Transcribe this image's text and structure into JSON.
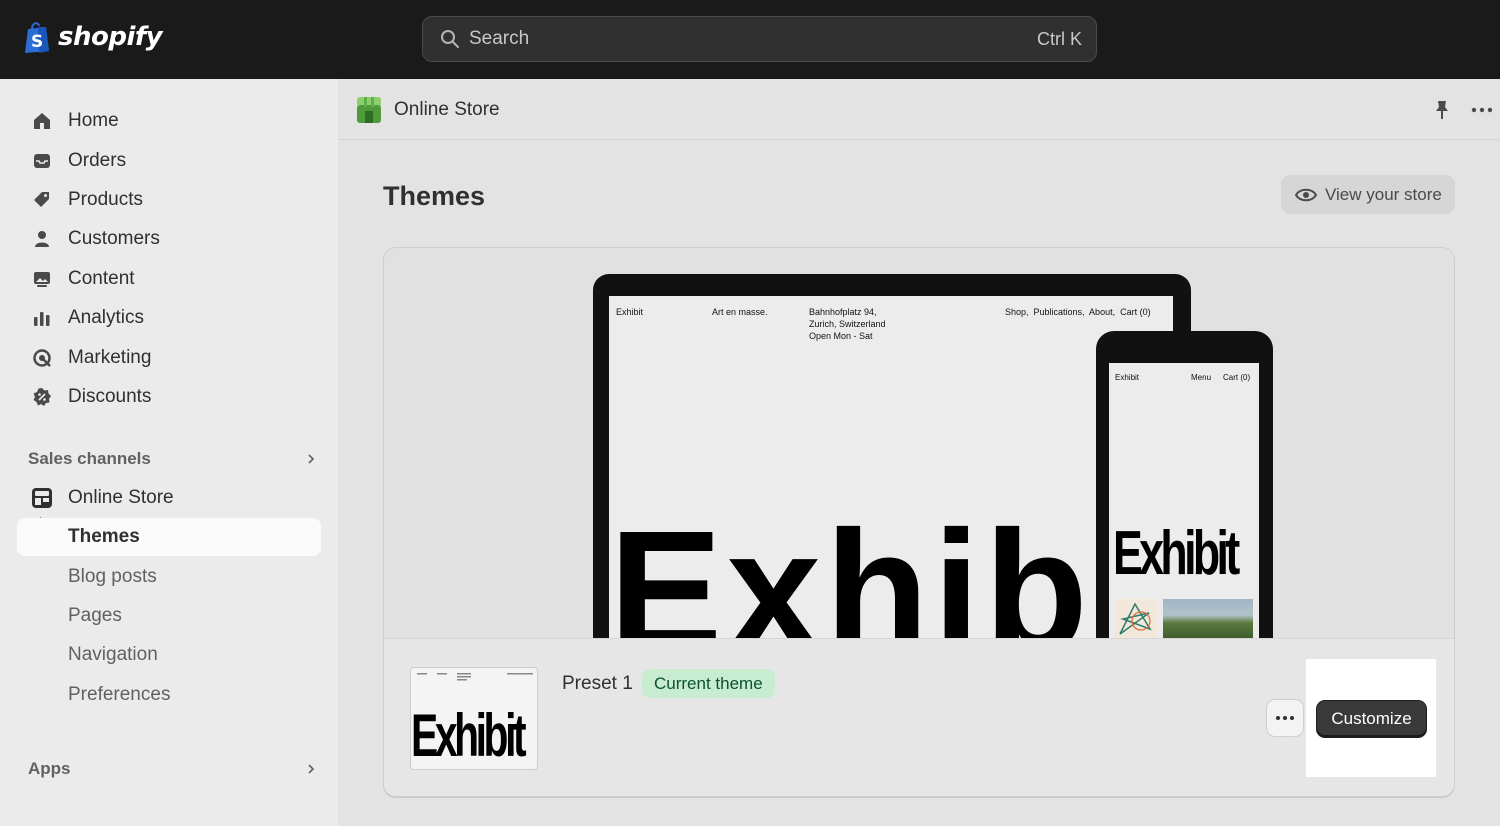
{
  "topbar": {
    "logo_text": "shopify",
    "search_placeholder": "Search",
    "search_shortcut": "Ctrl K"
  },
  "sidebar": {
    "items": [
      {
        "label": "Home",
        "icon": "home-icon"
      },
      {
        "label": "Orders",
        "icon": "inbox-icon"
      },
      {
        "label": "Products",
        "icon": "tag-icon"
      },
      {
        "label": "Customers",
        "icon": "person-icon"
      },
      {
        "label": "Content",
        "icon": "image-icon"
      },
      {
        "label": "Analytics",
        "icon": "bar-chart-icon"
      },
      {
        "label": "Marketing",
        "icon": "target-icon"
      },
      {
        "label": "Discounts",
        "icon": "discount-icon"
      }
    ],
    "sales_channels_label": "Sales channels",
    "online_store_label": "Online Store",
    "sub_items": [
      {
        "label": "Themes",
        "active": true
      },
      {
        "label": "Blog posts"
      },
      {
        "label": "Pages"
      },
      {
        "label": "Navigation"
      },
      {
        "label": "Preferences"
      }
    ],
    "apps_label": "Apps"
  },
  "appbar": {
    "title": "Online Store"
  },
  "page": {
    "title": "Themes",
    "view_store_label": "View your store"
  },
  "theme_card": {
    "laptop": {
      "brand": "Exhibit",
      "tagline": "Art en masse.",
      "address": [
        "Bahnhofplatz 94,",
        "Zurich, Switzerland",
        "Open Mon - Sat"
      ],
      "nav": "Shop,  Publications,  About,  Cart (0)",
      "big_word": "Exhibit"
    },
    "phone": {
      "brand": "Exhibit",
      "menu": "Menu",
      "cart": "Cart (0)",
      "big_word": "Exhibit"
    },
    "thumb_word": "Exhibit",
    "preset_name": "Preset 1",
    "badge": "Current theme",
    "customize_label": "Customize"
  },
  "colors": {
    "topbar_bg": "#1a1a1a",
    "badge_bg": "#c7ecd0",
    "badge_text": "#0c5132",
    "customize_bg": "#3a3a3a"
  }
}
